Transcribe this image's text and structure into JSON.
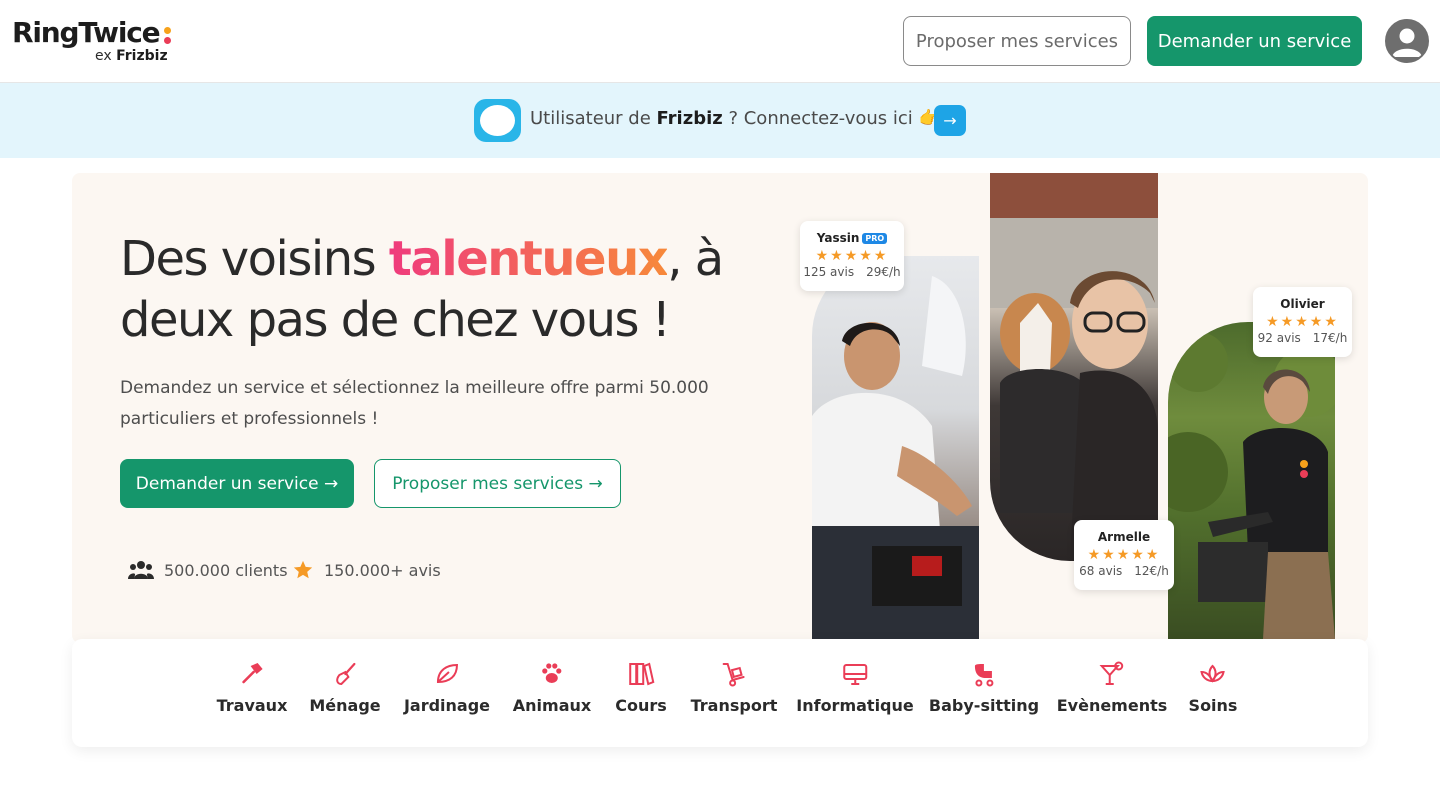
{
  "header": {
    "logo_main": "RingTwice",
    "logo_sub_prefix": "ex",
    "logo_sub_brand": "Frizbiz",
    "propose_button": "Proposer mes services",
    "request_button": "Demander un service"
  },
  "banner": {
    "text_prefix": "Utilisateur de ",
    "brand": "Frizbiz",
    "text_suffix": " ? Connectez-vous ici 👉",
    "arrow": "→"
  },
  "hero": {
    "title_start": "Des voisins ",
    "title_highlight": "talentueux",
    "title_end": ", à deux pas de chez vous !",
    "subtitle": "Demandez un service et sélectionnez la meilleure offre parmi 50.000 particuliers et professionnels !",
    "cta_request": "Demander un service →",
    "cta_propose": "Proposer mes services →",
    "stats": {
      "clients": "500.000 clients",
      "reviews": "150.000+ avis"
    }
  },
  "providers": [
    {
      "name": "Yassin",
      "badge": "PRO",
      "stars": "★★★★★",
      "reviews": "125 avis",
      "rate": "29€/h"
    },
    {
      "name": "Olivier",
      "badge": "",
      "stars": "★★★★★",
      "reviews": "92 avis",
      "rate": "17€/h"
    },
    {
      "name": "Armelle",
      "badge": "",
      "stars": "★★★★★",
      "reviews": "68 avis",
      "rate": "12€/h"
    }
  ],
  "categories": [
    {
      "label": "Travaux",
      "icon": "hammer-icon"
    },
    {
      "label": "Ménage",
      "icon": "broom-icon"
    },
    {
      "label": "Jardinage",
      "icon": "leaf-icon"
    },
    {
      "label": "Animaux",
      "icon": "paw-icon"
    },
    {
      "label": "Cours",
      "icon": "books-icon"
    },
    {
      "label": "Transport",
      "icon": "handtruck-icon"
    },
    {
      "label": "Informatique",
      "icon": "computer-icon"
    },
    {
      "label": "Baby-sitting",
      "icon": "stroller-icon"
    },
    {
      "label": "Evènements",
      "icon": "cocktail-icon"
    },
    {
      "label": "Soins",
      "icon": "lotus-icon"
    }
  ],
  "colors": {
    "brand_green": "#15966b",
    "banner_bg": "#e3f5fc",
    "frizbiz_blue": "#29b5e8",
    "hero_bg": "#fcf7f2",
    "category_icon": "#ea3d57",
    "star": "#f59a26",
    "logo_dot_top": "#f7a21b",
    "logo_dot_bottom": "#ea3d57"
  }
}
